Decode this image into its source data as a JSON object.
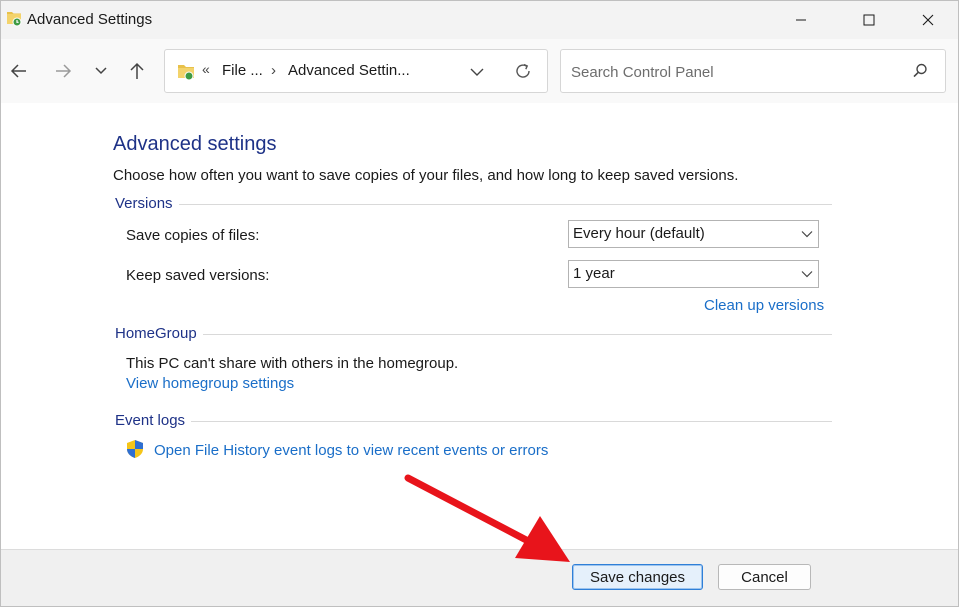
{
  "window": {
    "title": "Advanced Settings"
  },
  "nav": {
    "overflow": "«",
    "breadcrumb": [
      "File ...",
      "Advanced Settin..."
    ],
    "separator": "›"
  },
  "search": {
    "placeholder": "Search Control Panel"
  },
  "main": {
    "heading": "Advanced settings",
    "intro": "Choose how often you want to save copies of your files, and how long to keep saved versions.",
    "versions": {
      "label": "Versions",
      "save_copies_label": "Save copies of files:",
      "save_copies_value": "Every hour (default)",
      "keep_versions_label": "Keep saved versions:",
      "keep_versions_value": "1 year",
      "cleanup_link": "Clean up versions"
    },
    "homegroup": {
      "label": "HomeGroup",
      "status": "This PC can't share with others in the homegroup.",
      "view_link": "View homegroup settings"
    },
    "event_logs": {
      "label": "Event logs",
      "open_link": "Open File History event logs to view recent events or errors"
    }
  },
  "footer": {
    "save_label": "Save changes",
    "cancel_label": "Cancel"
  },
  "colors": {
    "heading": "#1e3287",
    "link": "#1a6ec8",
    "annotation_arrow": "#e8141b"
  },
  "icons": [
    "file-history-icon",
    "minimize-icon",
    "maximize-icon",
    "close-icon",
    "back-arrow-icon",
    "forward-arrow-icon",
    "recent-chevron-icon",
    "up-arrow-icon",
    "folder-icon",
    "chevron-down-icon",
    "refresh-icon",
    "search-icon",
    "shield-icon"
  ]
}
